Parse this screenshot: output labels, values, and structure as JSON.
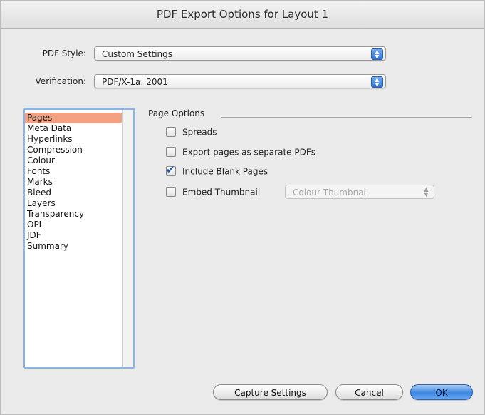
{
  "window": {
    "title": "PDF Export Options for Layout 1"
  },
  "pdf_style": {
    "label": "PDF Style:",
    "value": "Custom Settings"
  },
  "verification": {
    "label": "Verification:",
    "value": "PDF/X-1a: 2001"
  },
  "sidebar": {
    "items": [
      {
        "label": "Pages",
        "selected": true
      },
      {
        "label": "Meta Data"
      },
      {
        "label": "Hyperlinks"
      },
      {
        "label": "Compression"
      },
      {
        "label": "Colour"
      },
      {
        "label": "Fonts"
      },
      {
        "label": "Marks"
      },
      {
        "label": "Bleed"
      },
      {
        "label": "Layers"
      },
      {
        "label": "Transparency"
      },
      {
        "label": "OPI"
      },
      {
        "label": "JDF"
      },
      {
        "label": "Summary"
      }
    ]
  },
  "page_options": {
    "title": "Page Options",
    "spreads": {
      "label": "Spreads",
      "checked": false
    },
    "separate": {
      "label": "Export pages as separate PDFs",
      "checked": false
    },
    "blank": {
      "label": "Include Blank Pages",
      "checked": true
    },
    "thumbnail": {
      "label": "Embed Thumbnail",
      "checked": false,
      "popup_value": "Colour Thumbnail"
    }
  },
  "buttons": {
    "capture": "Capture Settings",
    "cancel": "Cancel",
    "ok": "OK"
  },
  "colors": {
    "accent_blue": "#3d87e2",
    "selection": "#f3a182"
  }
}
